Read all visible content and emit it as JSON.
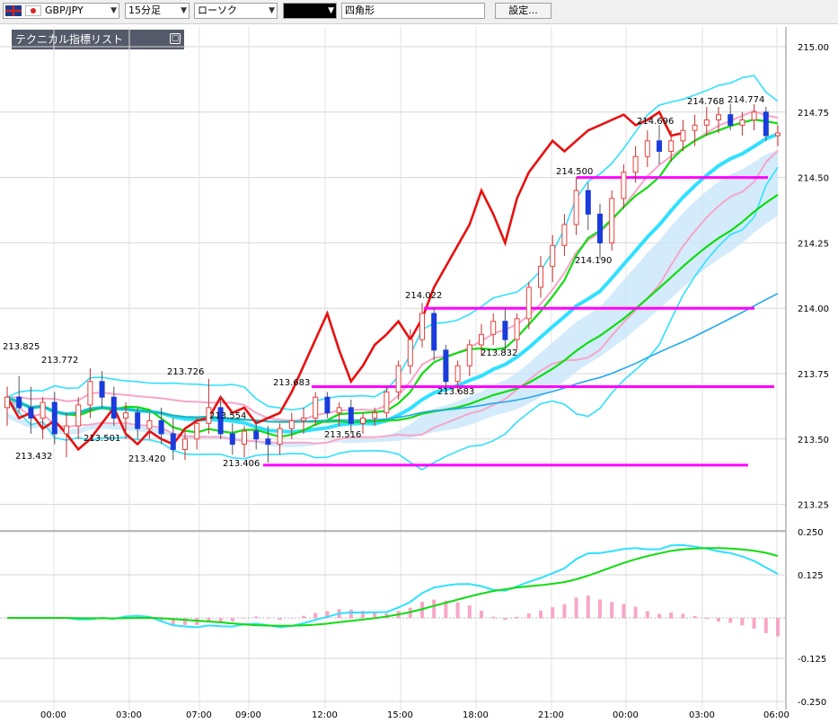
{
  "toolbar": {
    "symbol": "GBP/JPY",
    "timeframe": "15分足",
    "chart_style": "ローソク",
    "drawing_tool_value": "",
    "shape_label": "四角形",
    "settings_label": "設定..."
  },
  "tech_panel": {
    "title": "テクニカル指標リスト",
    "button_label": "▢"
  },
  "colors": {
    "up": "#e8413c",
    "down": "#1a3cdc",
    "bollinger": "#30e0ff",
    "pink": "#f7a6c8",
    "green": "#10dc10",
    "red_line": "#e81010",
    "support": "#ff00ff",
    "cloud": "#c8e6fa",
    "sma": "#20a8f0"
  },
  "chart_data": [
    {
      "type": "candlestick",
      "y_ticks": [
        "215.00",
        "214.75",
        "214.50",
        "214.25",
        "214.00",
        "213.75",
        "213.50",
        "213.25"
      ],
      "x_ticks": [
        "00:00",
        "03:00",
        "07:00",
        "09:00",
        "12:00",
        "15:00",
        "18:00",
        "21:00",
        "00:00",
        "03:00",
        "06:00"
      ],
      "annotations": [
        "213.825",
        "213.772",
        "213.726",
        "213.554",
        "213.501",
        "213.420",
        "213.432",
        "213.406",
        "213.683",
        "213.516",
        "214.022",
        "213.832",
        "213.683",
        "214.500",
        "214.190",
        "214.696",
        "214.768",
        "214.774"
      ],
      "support_lines": [
        214.5,
        214.0,
        213.7,
        213.4
      ],
      "ohlc": [
        [
          213.62,
          213.7,
          213.55,
          213.66
        ],
        [
          213.66,
          213.74,
          213.6,
          213.62
        ],
        [
          213.62,
          213.7,
          213.52,
          213.58
        ],
        [
          213.58,
          213.66,
          213.5,
          213.64
        ],
        [
          213.64,
          213.68,
          213.48,
          213.52
        ],
        [
          213.52,
          213.6,
          213.43,
          213.55
        ],
        [
          213.55,
          213.66,
          213.5,
          213.63
        ],
        [
          213.63,
          213.77,
          213.58,
          213.72
        ],
        [
          213.72,
          213.76,
          213.62,
          213.66
        ],
        [
          213.66,
          213.7,
          213.55,
          213.58
        ],
        [
          213.58,
          213.64,
          213.5,
          213.6
        ],
        [
          213.6,
          213.62,
          213.5,
          213.54
        ],
        [
          213.54,
          213.6,
          213.5,
          213.57
        ],
        [
          213.57,
          213.62,
          213.48,
          213.52
        ],
        [
          213.52,
          213.58,
          213.42,
          213.46
        ],
        [
          213.46,
          213.54,
          213.42,
          213.5
        ],
        [
          213.5,
          213.58,
          213.46,
          213.56
        ],
        [
          213.56,
          213.73,
          213.52,
          213.62
        ],
        [
          213.62,
          213.66,
          213.5,
          213.52
        ],
        [
          213.52,
          213.56,
          213.44,
          213.48
        ],
        [
          213.48,
          213.55,
          213.43,
          213.53
        ],
        [
          213.53,
          213.57,
          213.46,
          213.5
        ],
        [
          213.5,
          213.55,
          213.41,
          213.48
        ],
        [
          213.48,
          213.56,
          213.44,
          213.54
        ],
        [
          213.54,
          213.6,
          213.5,
          213.57
        ],
        [
          213.57,
          213.62,
          213.52,
          213.58
        ],
        [
          213.58,
          213.68,
          213.55,
          213.66
        ],
        [
          213.66,
          213.68,
          213.58,
          213.6
        ],
        [
          213.6,
          213.64,
          213.55,
          213.62
        ],
        [
          213.62,
          213.65,
          213.52,
          213.56
        ],
        [
          213.56,
          213.6,
          213.52,
          213.58
        ],
        [
          213.58,
          213.62,
          213.55,
          213.6
        ],
        [
          213.6,
          213.7,
          213.58,
          213.68
        ],
        [
          213.68,
          213.8,
          213.65,
          213.78
        ],
        [
          213.78,
          213.92,
          213.75,
          213.88
        ],
        [
          213.88,
          214.02,
          213.85,
          213.98
        ],
        [
          213.98,
          214.0,
          213.8,
          213.84
        ],
        [
          213.84,
          213.86,
          213.68,
          213.72
        ],
        [
          213.72,
          213.8,
          213.68,
          213.78
        ],
        [
          213.78,
          213.88,
          213.74,
          213.86
        ],
        [
          213.86,
          213.94,
          213.82,
          213.9
        ],
        [
          213.9,
          213.98,
          213.86,
          213.95
        ],
        [
          213.95,
          214.0,
          213.83,
          213.88
        ],
        [
          213.88,
          213.98,
          213.84,
          213.96
        ],
        [
          213.96,
          214.1,
          213.92,
          214.08
        ],
        [
          214.08,
          214.2,
          214.04,
          214.16
        ],
        [
          214.16,
          214.28,
          214.1,
          214.24
        ],
        [
          214.24,
          214.36,
          214.2,
          214.32
        ],
        [
          214.32,
          214.5,
          214.28,
          214.45
        ],
        [
          214.45,
          214.48,
          214.3,
          214.36
        ],
        [
          214.36,
          214.4,
          214.19,
          214.25
        ],
        [
          214.25,
          214.45,
          214.22,
          214.42
        ],
        [
          214.42,
          214.55,
          214.38,
          214.52
        ],
        [
          214.52,
          214.62,
          214.48,
          214.58
        ],
        [
          214.58,
          214.68,
          214.54,
          214.64
        ],
        [
          214.64,
          214.7,
          214.55,
          214.6
        ],
        [
          214.6,
          214.68,
          214.56,
          214.64
        ],
        [
          214.64,
          214.72,
          214.6,
          214.68
        ],
        [
          214.68,
          214.74,
          214.62,
          214.7
        ],
        [
          214.7,
          214.77,
          214.66,
          214.72
        ],
        [
          214.72,
          214.77,
          214.67,
          214.74
        ],
        [
          214.74,
          214.78,
          214.68,
          214.7
        ],
        [
          214.7,
          214.75,
          214.66,
          214.72
        ],
        [
          214.72,
          214.78,
          214.68,
          214.75
        ],
        [
          214.75,
          214.77,
          214.64,
          214.66
        ],
        [
          214.66,
          214.7,
          214.62,
          214.67
        ]
      ]
    },
    {
      "type": "line",
      "y_ticks": [
        "0.250",
        "0.125",
        "-0.125",
        "-0.250"
      ]
    }
  ]
}
